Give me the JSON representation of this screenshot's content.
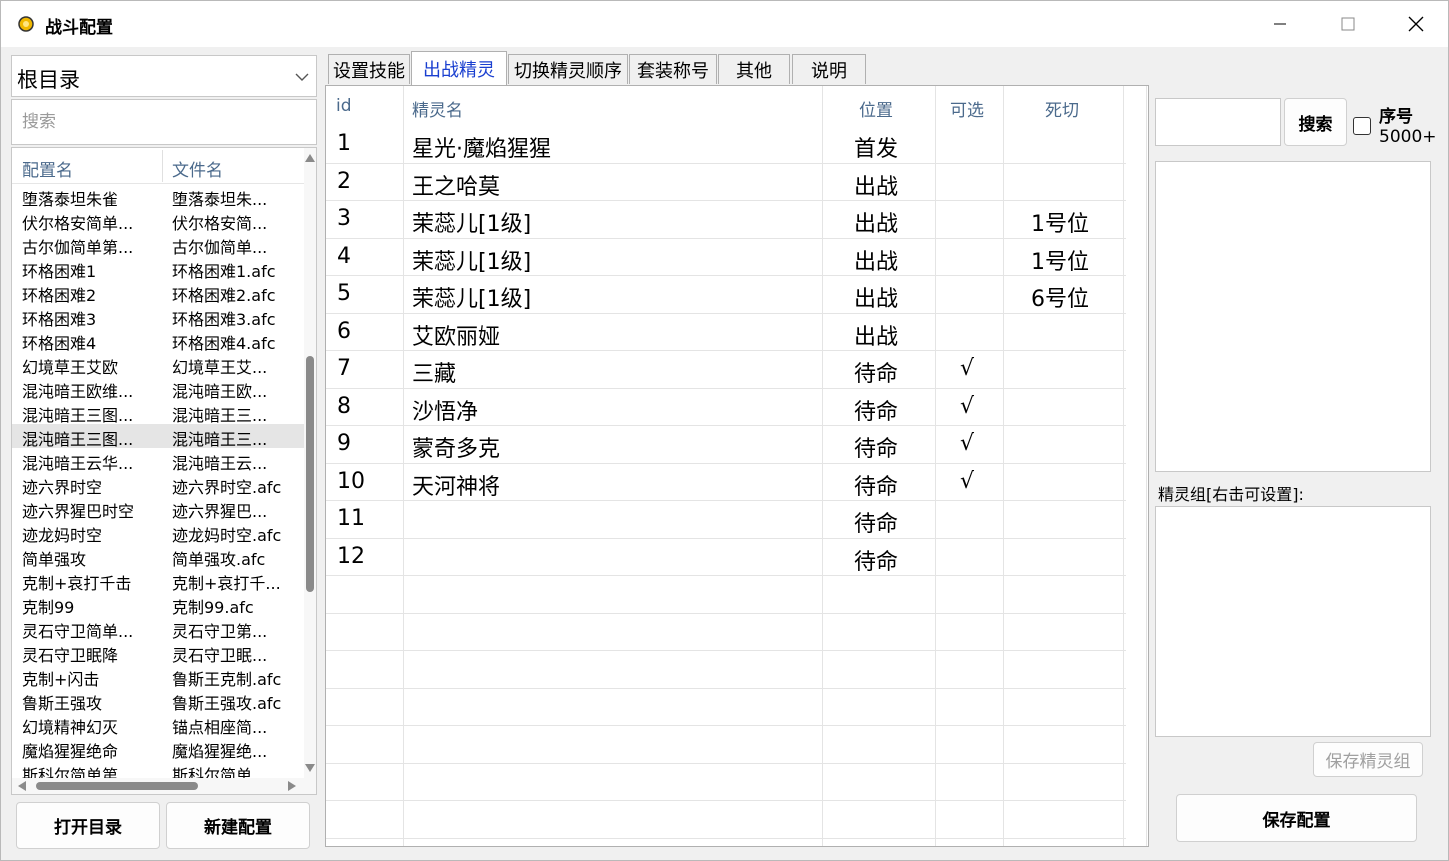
{
  "window": {
    "title": "战斗配置"
  },
  "left": {
    "root_select": "根目录",
    "search_placeholder": "搜索",
    "headers": {
      "config_name": "配置名",
      "file_name": "文件名"
    },
    "items": [
      {
        "name": "堕落泰坦朱雀",
        "file": "堕落泰坦朱..."
      },
      {
        "name": "伏尔格安简单...",
        "file": "伏尔格安简..."
      },
      {
        "name": "古尔伽简单第...",
        "file": "古尔伽简单..."
      },
      {
        "name": "环格困难1",
        "file": "环格困难1.afc"
      },
      {
        "name": "环格困难2",
        "file": "环格困难2.afc"
      },
      {
        "name": "环格困难3",
        "file": "环格困难3.afc"
      },
      {
        "name": "环格困难4",
        "file": "环格困难4.afc"
      },
      {
        "name": "幻境草王艾欧",
        "file": "幻境草王艾..."
      },
      {
        "name": "混沌暗王欧维...",
        "file": "混沌暗王欧..."
      },
      {
        "name": "混沌暗王三图...",
        "file": "混沌暗王三..."
      },
      {
        "name": "混沌暗王三图...",
        "file": "混沌暗王三..."
      },
      {
        "name": "混沌暗王云华...",
        "file": "混沌暗王云..."
      },
      {
        "name": "迹六界时空",
        "file": "迹六界时空.afc"
      },
      {
        "name": "迹六界猩巴时空",
        "file": "迹六界猩巴..."
      },
      {
        "name": "迹龙妈时空",
        "file": "迹龙妈时空.afc"
      },
      {
        "name": "简单强攻",
        "file": "简单强攻.afc"
      },
      {
        "name": "克制+哀打千击",
        "file": "克制+哀打千..."
      },
      {
        "name": "克制99",
        "file": "克制99.afc"
      },
      {
        "name": "灵石守卫简单...",
        "file": "灵石守卫第..."
      },
      {
        "name": "灵石守卫眠降",
        "file": "灵石守卫眠..."
      },
      {
        "name": "克制+闪击",
        "file": "鲁斯王克制.afc"
      },
      {
        "name": "鲁斯王强攻",
        "file": "鲁斯王强攻.afc"
      },
      {
        "name": "幻境精神幻灭",
        "file": "锚点相座简..."
      },
      {
        "name": "魔焰猩猩绝命",
        "file": "魔焰猩猩绝..."
      },
      {
        "name": "斯科尔简单第...",
        "file": "斯科尔简单..."
      }
    ],
    "open_dir_button": "打开目录",
    "new_config_button": "新建配置"
  },
  "tabs": [
    "设置技能",
    "出战精灵",
    "切换精灵顺序",
    "套装称号",
    "其他",
    "说明"
  ],
  "grid": {
    "headers": {
      "id": "id",
      "name": "精灵名",
      "position": "位置",
      "selectable": "可选",
      "death_switch": "死切"
    },
    "rows": [
      {
        "id": "1",
        "name": "星光·魔焰猩猩",
        "position": "首发",
        "selectable": "",
        "death_switch": ""
      },
      {
        "id": "2",
        "name": "王之哈莫",
        "position": "出战",
        "selectable": "",
        "death_switch": ""
      },
      {
        "id": "3",
        "name": "茉蕊儿[1级]",
        "position": "出战",
        "selectable": "",
        "death_switch": "1号位"
      },
      {
        "id": "4",
        "name": "茉蕊儿[1级]",
        "position": "出战",
        "selectable": "",
        "death_switch": "1号位"
      },
      {
        "id": "5",
        "name": "茉蕊儿[1级]",
        "position": "出战",
        "selectable": "",
        "death_switch": "6号位"
      },
      {
        "id": "6",
        "name": "艾欧丽娅",
        "position": "出战",
        "selectable": "",
        "death_switch": ""
      },
      {
        "id": "7",
        "name": "三藏",
        "position": "待命",
        "selectable": "√",
        "death_switch": ""
      },
      {
        "id": "8",
        "name": "沙悟净",
        "position": "待命",
        "selectable": "√",
        "death_switch": ""
      },
      {
        "id": "9",
        "name": "蒙奇多克",
        "position": "待命",
        "selectable": "√",
        "death_switch": ""
      },
      {
        "id": "10",
        "name": "天河神将",
        "position": "待命",
        "selectable": "√",
        "death_switch": ""
      },
      {
        "id": "11",
        "name": "",
        "position": "待命",
        "selectable": "",
        "death_switch": ""
      },
      {
        "id": "12",
        "name": "",
        "position": "待命",
        "selectable": "",
        "death_switch": ""
      },
      {
        "id": "",
        "name": "",
        "position": "",
        "selectable": "",
        "death_switch": ""
      },
      {
        "id": "",
        "name": "",
        "position": "",
        "selectable": "",
        "death_switch": ""
      },
      {
        "id": "",
        "name": "",
        "position": "",
        "selectable": "",
        "death_switch": ""
      },
      {
        "id": "",
        "name": "",
        "position": "",
        "selectable": "",
        "death_switch": ""
      },
      {
        "id": "",
        "name": "",
        "position": "",
        "selectable": "",
        "death_switch": ""
      },
      {
        "id": "",
        "name": "",
        "position": "",
        "selectable": "",
        "death_switch": ""
      },
      {
        "id": "",
        "name": "",
        "position": "",
        "selectable": "",
        "death_switch": ""
      }
    ]
  },
  "right": {
    "search_button": "搜索",
    "seq_label": "序号",
    "seq_value": "5000+",
    "group_label": "精灵组[右击可设置]:",
    "save_group_button": "保存精灵组",
    "save_config_button": "保存配置"
  },
  "icons": {
    "app": "app-icon",
    "minimize": "minimize-icon",
    "maximize": "maximize-icon",
    "close": "close-icon",
    "dropdown": "chevron-down-icon"
  },
  "colors": {
    "active_tab_text": "#1a3fd0",
    "header_text": "#4b6a8c",
    "app_icon": "#f0b800"
  }
}
